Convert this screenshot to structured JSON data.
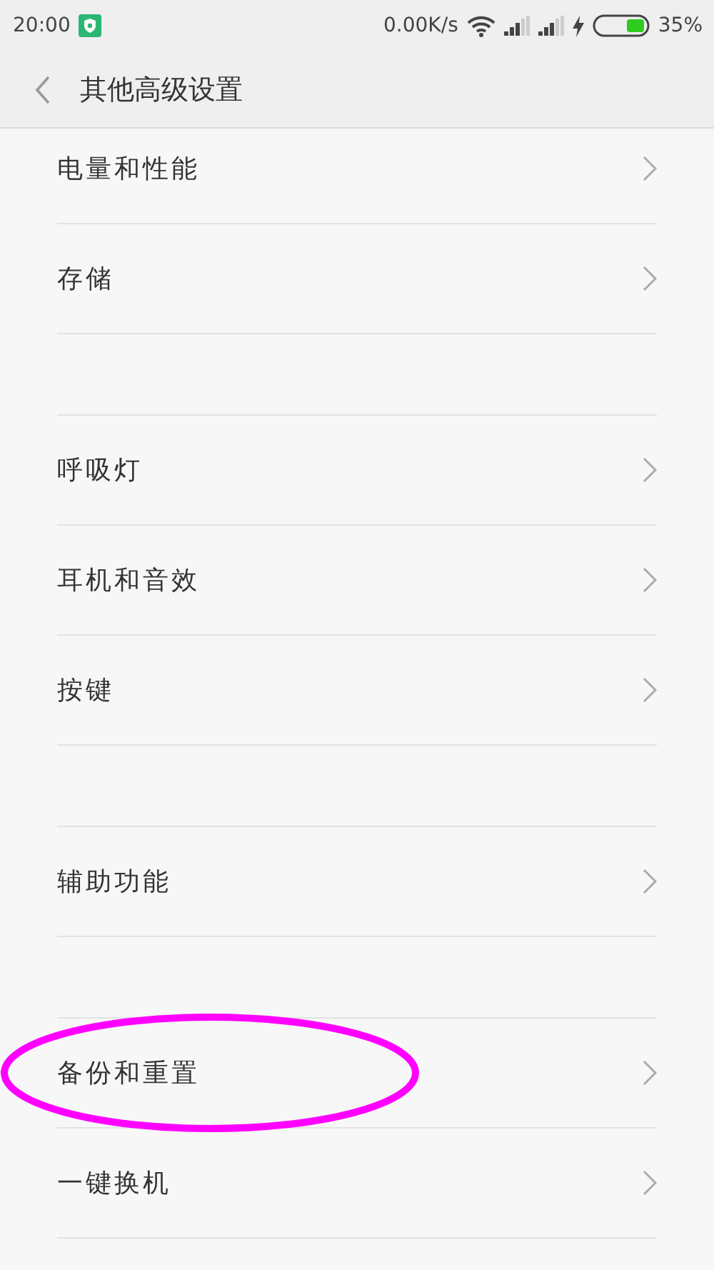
{
  "status_bar": {
    "time": "20:00",
    "net_speed": "0.00K/s",
    "battery": "35%"
  },
  "header": {
    "title": "其他高级设置"
  },
  "groups": [
    {
      "items": [
        {
          "label": "电量和性能",
          "highlighted": false
        },
        {
          "label": "存储",
          "highlighted": false
        }
      ]
    },
    {
      "items": [
        {
          "label": "呼吸灯",
          "highlighted": false
        },
        {
          "label": "耳机和音效",
          "highlighted": false
        },
        {
          "label": "按键",
          "highlighted": false
        }
      ]
    },
    {
      "items": [
        {
          "label": "辅助功能",
          "highlighted": false
        }
      ]
    },
    {
      "items": [
        {
          "label": "备份和重置",
          "highlighted": true
        },
        {
          "label": "一键换机",
          "highlighted": false
        }
      ]
    }
  ]
}
